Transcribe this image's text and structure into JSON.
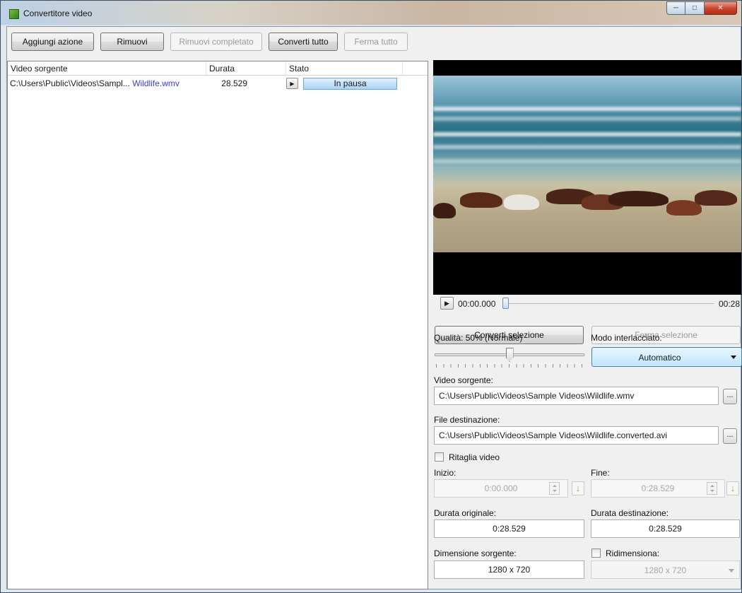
{
  "window": {
    "title": "Convertitore video",
    "controls": [
      "minimize",
      "maximize",
      "close"
    ]
  },
  "toolbar": {
    "add_label": "Aggiungi azione",
    "remove_label": "Rimuovi",
    "remove_completed_label": "Rimuovi completato",
    "convert_all_label": "Converti tutto",
    "stop_all_label": "Ferma tutto"
  },
  "list": {
    "columns": [
      "Video sorgente",
      "Durata",
      "Stato"
    ],
    "rows": [
      {
        "path_prefix": "C:\\Users\\Public\\Videos\\Sampl...",
        "file": "Wildlife.wmv",
        "duration": "28.529",
        "status": "In pausa"
      }
    ]
  },
  "player": {
    "current_time": "00:00.000",
    "end_time": "00:28",
    "progress": 0.0
  },
  "actions": {
    "convert_selection": "Converti selezione",
    "stop_selection": "Ferma selezione"
  },
  "quality": {
    "label": "Qualità: 50% (Normale)",
    "value_percent": 50
  },
  "interlace": {
    "label": "Modo interlacciato:",
    "value": "Automatico"
  },
  "source_video": {
    "label": "Video sorgente:",
    "value": "C:\\Users\\Public\\Videos\\Sample Videos\\Wildlife.wmv",
    "browse": "..."
  },
  "destination": {
    "label": "File destinazione:",
    "value": "C:\\Users\\Public\\Videos\\Sample Videos\\Wildlife.converted.avi",
    "browse": "..."
  },
  "trim": {
    "label": "Ritaglia video",
    "checked": false,
    "start_label": "Inizio:",
    "start_value": "0:00.000",
    "end_label": "Fine:",
    "end_value": "0:28.529"
  },
  "durations": {
    "original_label": "Durata originale:",
    "original_value": "0:28.529",
    "dest_label": "Durata destinazione:",
    "dest_value": "0:28.529"
  },
  "size": {
    "source_label": "Dimensione sorgente:",
    "source_value": "1280 x 720",
    "resize_label": "Ridimensiona:",
    "resize_checked": false,
    "resize_value": "1280 x 720"
  }
}
